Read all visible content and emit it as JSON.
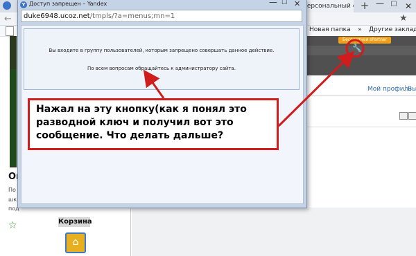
{
  "background_browser": {
    "tab_title": "персональный сайт",
    "new_tab_label": "+",
    "window_controls": {
      "minimize": "—",
      "maximize": "☐",
      "close": "✕"
    },
    "back_icon": "←",
    "bookmark_star": "★",
    "bookmarks": {
      "new_folder": "Новая папка",
      "more": "»",
      "other_bookmarks": "Другие закладки"
    },
    "partner_button": "Бесплатная sPartner",
    "user_links": {
      "profile": "Мой профиль",
      "separator": "|",
      "exit": "Вы"
    },
    "left_sidebar": {
      "heading": "Он",
      "lines": [
        "По",
        "шк",
        "под"
      ],
      "cart_title": "Корзина"
    }
  },
  "popup": {
    "title": "Доступ запрещен – Yandex",
    "logo_letter": "Y",
    "controls": {
      "minimize": "—",
      "maximize": "☐",
      "close": "✕"
    },
    "url_host": "duke6948.ucoz.net",
    "url_path": "/tmpls/?a=menus;mn=1",
    "message_line1": "Вы входите в группу пользователей, которым запрещено совершать данное действие.",
    "message_line2": "По всем вопросам обращайтесь к администратору сайта."
  },
  "annotation": {
    "text": "Нажал на эту кнопку(как я понял это разводной ключ и получил вот это сообщение. Что делать дальше?",
    "color": "#d01c1c"
  }
}
